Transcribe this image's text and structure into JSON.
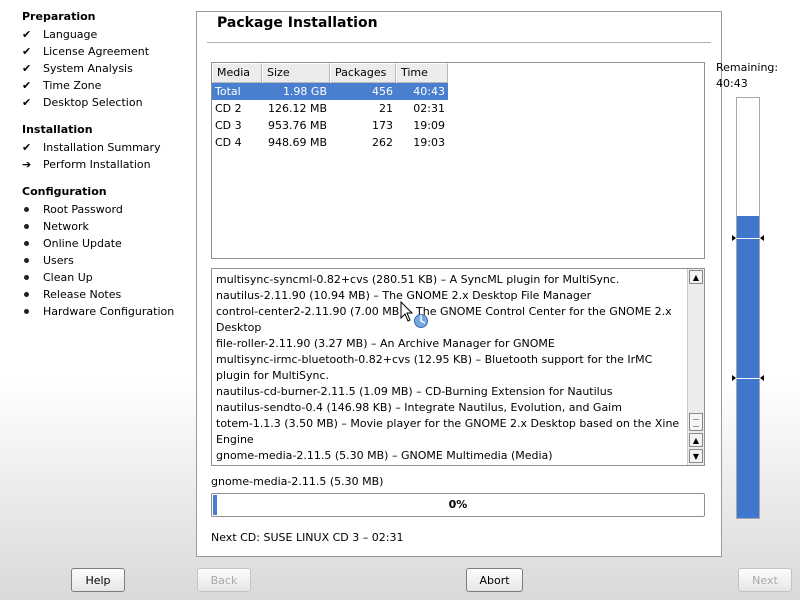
{
  "sidebar": {
    "sections": [
      {
        "title": "Preparation",
        "items": [
          {
            "label": "Language",
            "status": "done"
          },
          {
            "label": "License Agreement",
            "status": "done"
          },
          {
            "label": "System Analysis",
            "status": "done"
          },
          {
            "label": "Time Zone",
            "status": "done"
          },
          {
            "label": "Desktop Selection",
            "status": "done"
          }
        ]
      },
      {
        "title": "Installation",
        "items": [
          {
            "label": "Installation Summary",
            "status": "done"
          },
          {
            "label": "Perform Installation",
            "status": "current"
          }
        ]
      },
      {
        "title": "Configuration",
        "items": [
          {
            "label": "Root Password",
            "status": "pending"
          },
          {
            "label": "Network",
            "status": "pending"
          },
          {
            "label": "Online Update",
            "status": "pending"
          },
          {
            "label": "Users",
            "status": "pending"
          },
          {
            "label": "Clean Up",
            "status": "pending"
          },
          {
            "label": "Release Notes",
            "status": "pending"
          },
          {
            "label": "Hardware Configuration",
            "status": "pending"
          }
        ]
      }
    ]
  },
  "main": {
    "title": "Package Installation",
    "table": {
      "columns": [
        "Media",
        "Size",
        "Packages",
        "Time"
      ],
      "rows": [
        [
          "Total",
          "1.98 GB",
          "456",
          "40:43"
        ],
        [
          "CD 2",
          "126.12 MB",
          "21",
          "02:31"
        ],
        [
          "CD 3",
          "953.76 MB",
          "173",
          "19:09"
        ],
        [
          "CD 4",
          "948.69 MB",
          "262",
          "19:03"
        ]
      ],
      "selected_row": 0
    },
    "log": [
      "multisync-syncml-0.82+cvs (280.51 KB) – A SyncML plugin for MultiSync.",
      "nautilus-2.11.90 (10.94 MB) – The GNOME 2.x Desktop File Manager",
      "control-center2-2.11.90 (7.00 MB) – The GNOME Control Center for the GNOME 2.x Desktop",
      "file-roller-2.11.90 (3.27 MB) – An Archive Manager for GNOME",
      "multisync-irmc-bluetooth-0.82+cvs (12.95 KB) – Bluetooth support for the IrMC plugin for MultiSync.",
      "nautilus-cd-burner-2.11.5 (1.09 MB) – CD-Burning Extension for Nautilus",
      "nautilus-sendto-0.4 (146.98 KB) – Integrate Nautilus, Evolution, and Gaim",
      "totem-1.1.3 (3.50 MB) – Movie player for the GNOME 2.x Desktop based on the Xine Engine",
      "gnome-media-2.11.5 (5.30 MB) – GNOME Multimedia (Media)"
    ],
    "current_package": "gnome-media-2.11.5 (5.30 MB)",
    "progress": {
      "percent": 0,
      "label": "0%"
    },
    "next_cd": "Next CD: SUSE LINUX CD 3 – 02:31"
  },
  "remaining": {
    "label": "Remaining:",
    "time": "40:43",
    "filled_fraction": 0.72
  },
  "buttons": {
    "help": "Help",
    "back": "Back",
    "abort": "Abort",
    "next": "Next"
  },
  "colors": {
    "accent": "#4a7fd0",
    "bar_fill": "#3f77cf"
  }
}
